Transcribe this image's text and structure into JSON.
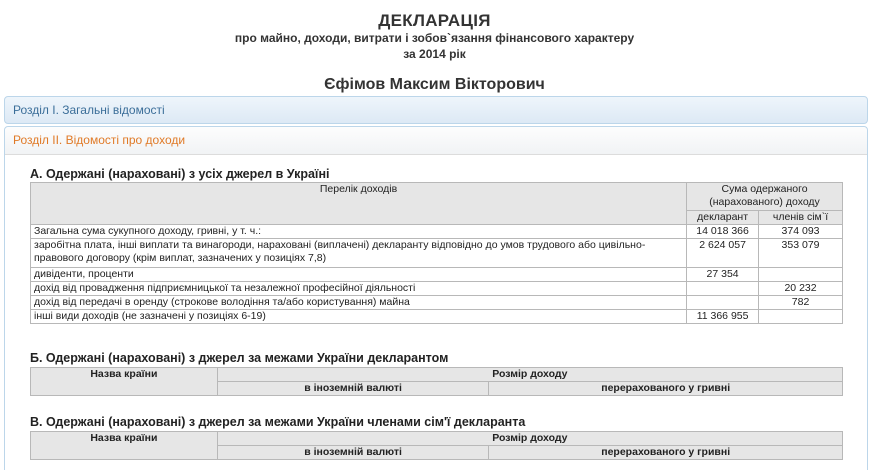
{
  "header": {
    "title": "ДЕКЛАРАЦІЯ",
    "subtitle": "про майно, доходи, витрати і зобов`язання фінансового характеру",
    "year": "за 2014 рік",
    "person": "Єфімов Максим Вікторович"
  },
  "panels": {
    "section1": "Розділ І. Загальні відомості",
    "section2": "Розділ ІІ. Відомості про доходи"
  },
  "sectionA": {
    "heading": "А. Одержані (нараховані) з усіх джерел в Україні",
    "col_list": "Перелік доходів",
    "col_sum": "Сума одержаного (нарахованого) доходу",
    "col_declarant": "декларант",
    "col_family": "членів сім`ї",
    "rows": [
      {
        "label": "Загальна сума сукупного доходу, гривні, у т. ч.:",
        "declarant": "14 018 366",
        "family": "374 093"
      },
      {
        "label": "заробітна плата, інші виплати та винагороди, нараховані (виплачені) декларанту відповідно до умов трудового або цивільно-правового договору (крім виплат, зазначених у позиціях 7,8)",
        "declarant": "2 624 057",
        "family": "353 079"
      },
      {
        "label": "дивіденти, проценти",
        "declarant": "27 354",
        "family": ""
      },
      {
        "label": "дохід від провадження підприємницької та незалежної професійної діяльності",
        "declarant": "",
        "family": "20 232"
      },
      {
        "label": "дохід від передачі в оренду (строкове володіння та/або користування) майна",
        "declarant": "",
        "family": "782"
      },
      {
        "label": "інші види доходів (не зазначені у позиціях 6-19)",
        "declarant": "11 366 955",
        "family": ""
      }
    ]
  },
  "sectionB": {
    "heading": "Б. Одержані (нараховані) з джерел за межами України декларантом",
    "col_country": "Назва країни",
    "col_amount": "Розмір доходу",
    "col_foreign": "в іноземній валюті",
    "col_uah": "перерахованого у гривні"
  },
  "sectionC": {
    "heading": "В. Одержані (нараховані) з джерел за межами України членами сім'ї декларанта",
    "col_country": "Назва країни",
    "col_amount": "Розмір доходу",
    "col_foreign": "в іноземній валюті",
    "col_uah": "перерахованого у гривні"
  }
}
